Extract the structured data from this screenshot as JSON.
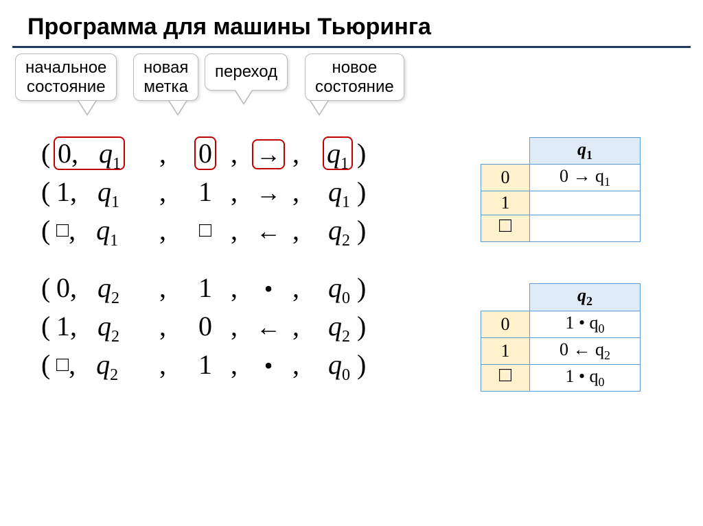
{
  "title": "Программа для машины Тьюринга",
  "callouts": {
    "c1a": "начальное",
    "c1b": "состояние",
    "c2a": "новая",
    "c2b": "метка",
    "c3": "переход",
    "c4a": "новое",
    "c4b": "состояние"
  },
  "tuples": {
    "group1": [
      {
        "open": "(",
        "sym": "0",
        "c1": ",",
        "q": "q",
        "qs": "1",
        "c2": ",",
        "mark": "0",
        "c3": ",",
        "dir": "→",
        "c4": ",",
        "qn": "q",
        "qns": "1",
        "close": ")",
        "hl": true
      },
      {
        "open": "(",
        "sym": "1",
        "c1": ",",
        "q": "q",
        "qs": "1",
        "c2": ",",
        "mark": "1",
        "c3": ",",
        "dir": "→",
        "c4": ",",
        "qn": "q",
        "qns": "1",
        "close": ")",
        "hl": false
      },
      {
        "open": "(",
        "sym": "□",
        "c1": ",",
        "q": "q",
        "qs": "1",
        "c2": ",",
        "mark": "□",
        "c3": ",",
        "dir": "←",
        "c4": ",",
        "qn": "q",
        "qns": "2",
        "close": ")",
        "hl": false
      }
    ],
    "group2": [
      {
        "open": "(",
        "sym": "0",
        "c1": ",",
        "q": "q",
        "qs": "2",
        "c2": ",",
        "mark": "1",
        "c3": ",",
        "dir": "•",
        "c4": ",",
        "qn": "q",
        "qns": "0",
        "close": ")",
        "hl": false
      },
      {
        "open": "(",
        "sym": "1",
        "c1": ",",
        "q": "q",
        "qs": "2",
        "c2": ",",
        "mark": "0",
        "c3": ",",
        "dir": "←",
        "c4": ",",
        "qn": "q",
        "qns": "2",
        "close": ")",
        "hl": false
      },
      {
        "open": "(",
        "sym": "□",
        "c1": ",",
        "q": "q",
        "qs": "2",
        "c2": ",",
        "mark": "1",
        "c3": ",",
        "dir": "•",
        "c4": ",",
        "qn": "q",
        "qns": "0",
        "close": ")",
        "hl": false
      }
    ]
  },
  "table1": {
    "head": "q",
    "headsub": "1",
    "r0s": "0",
    "r0c": "0 → q",
    "r0cs": "1",
    "r1s": "1",
    "r1c": "",
    "r2s": "□",
    "r2c": ""
  },
  "table2": {
    "head": "q",
    "headsub": "2",
    "r0s": "0",
    "r0c": "1 • q",
    "r0cs": "0",
    "r1s": "1",
    "r1c": "0 ← q",
    "r1cs": "2",
    "r2s": "□",
    "r2c": "1 • q",
    "r2cs": "0"
  }
}
